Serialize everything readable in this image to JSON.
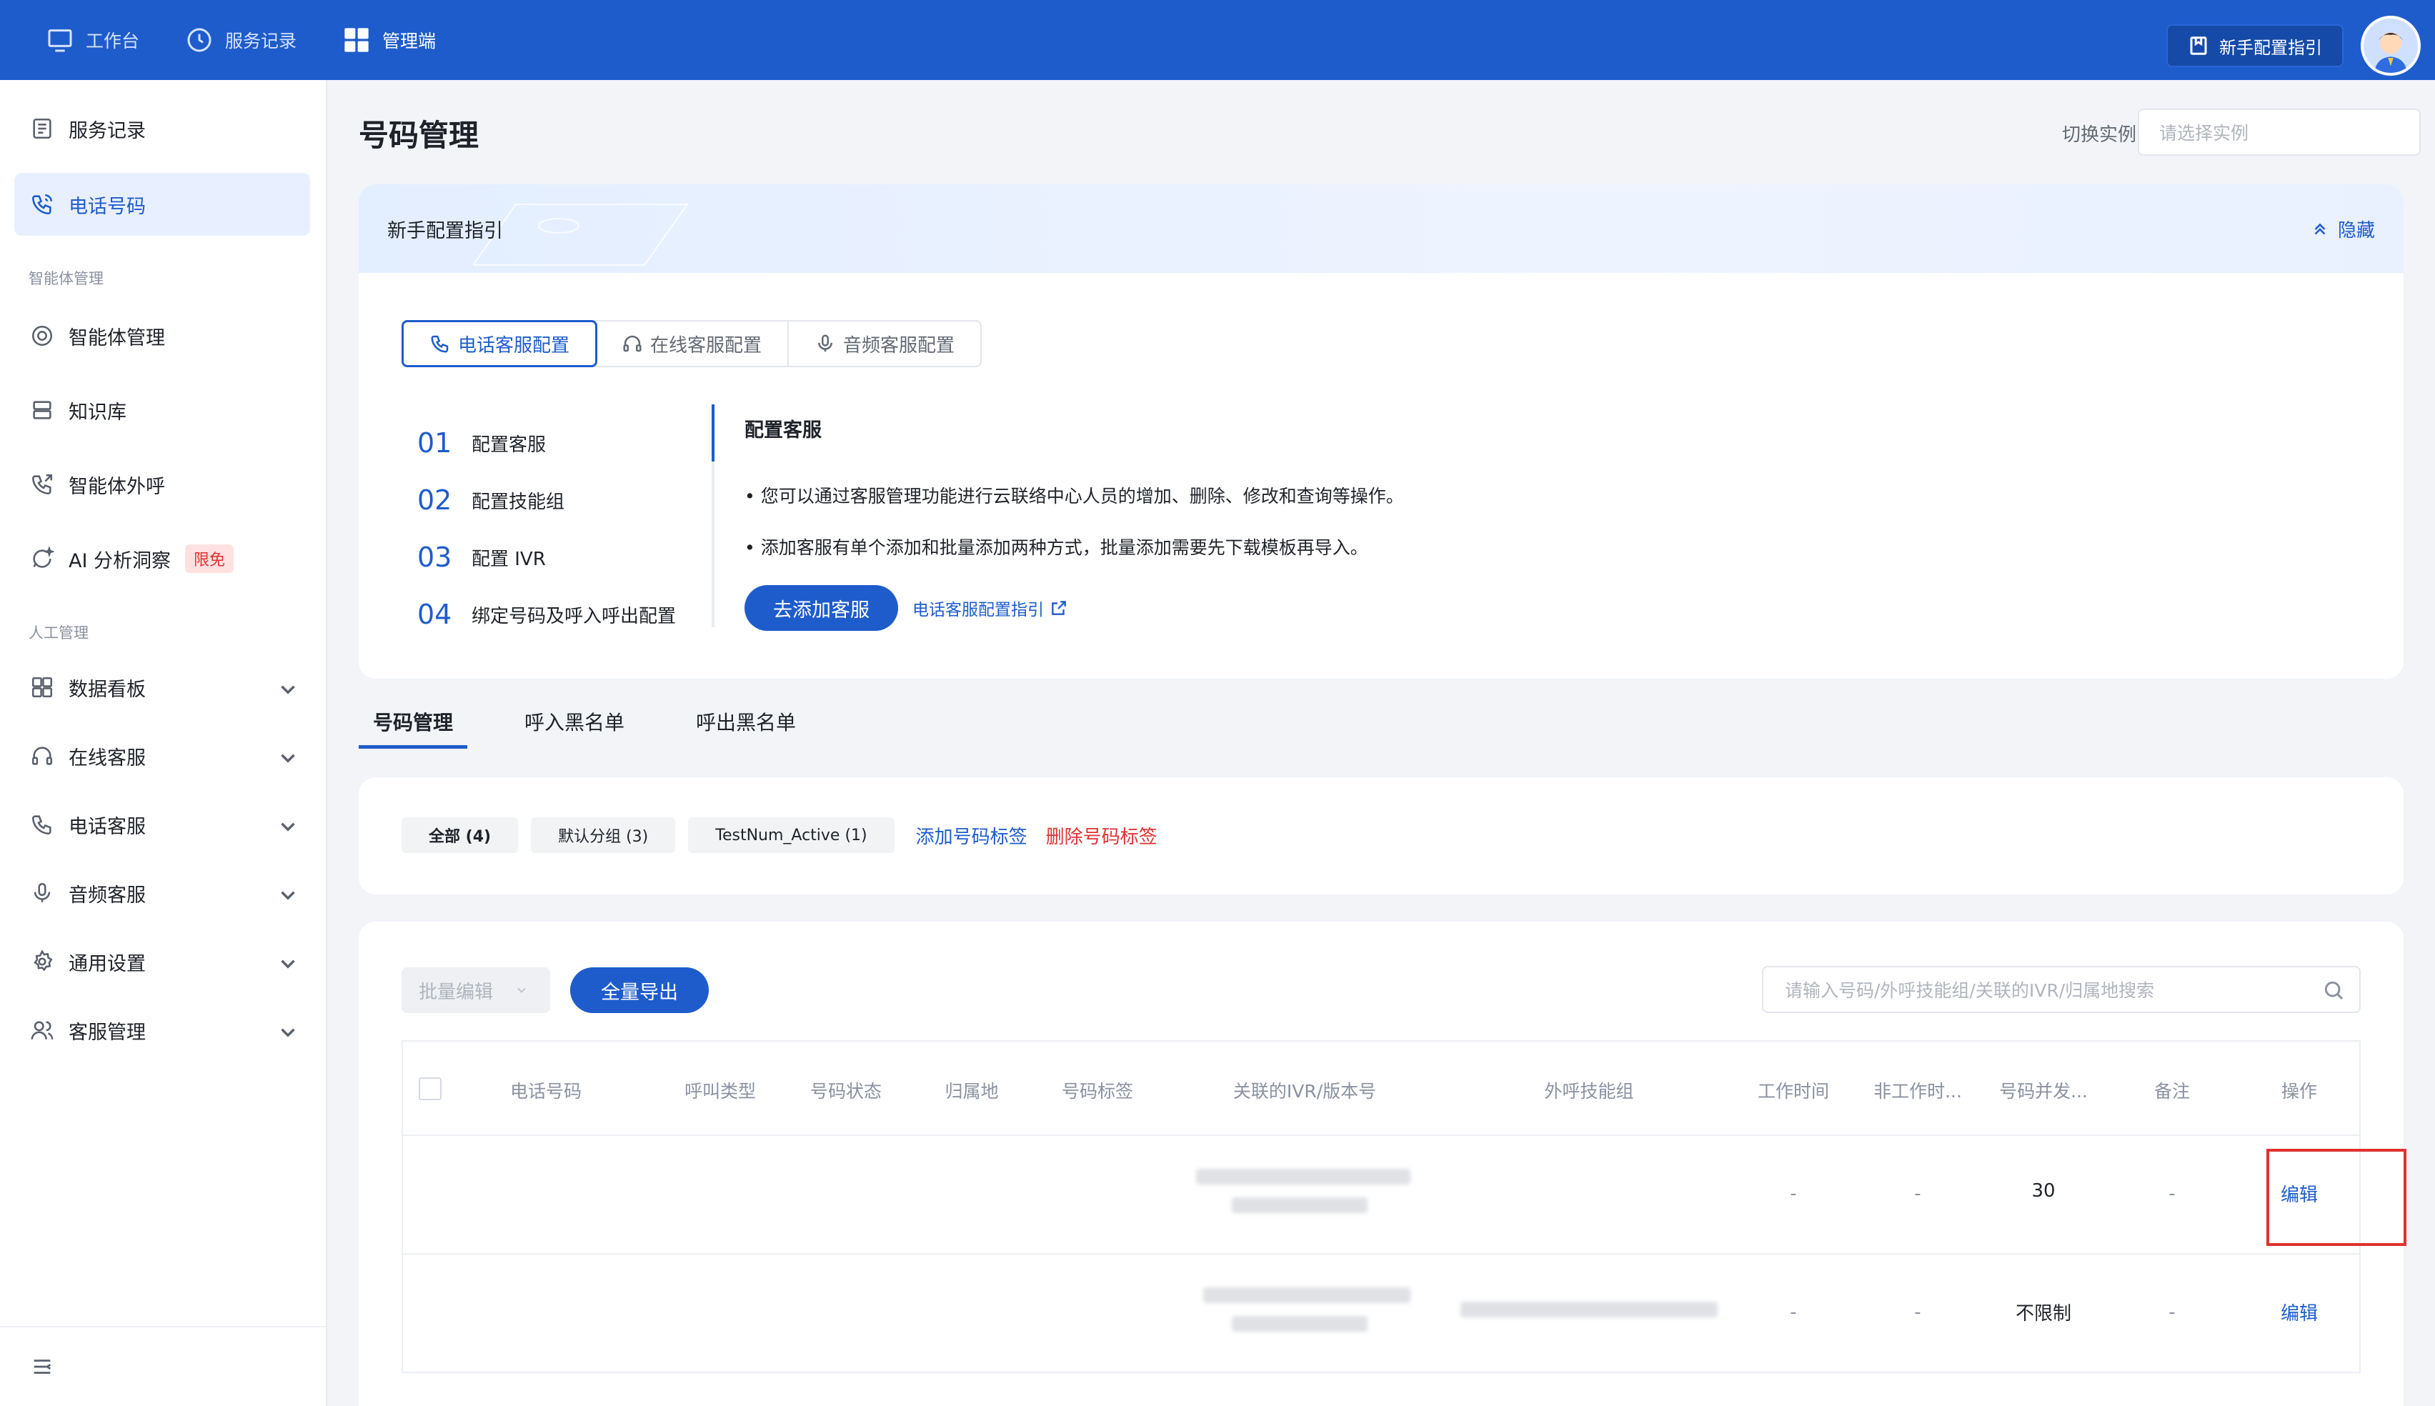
{
  "topbar": {
    "items": [
      {
        "label": "工作台",
        "icon": "monitor-icon"
      },
      {
        "label": "服务记录",
        "icon": "clock-icon"
      },
      {
        "label": "管理端",
        "icon": "grid-icon"
      }
    ],
    "guide_button": "新手配置指引"
  },
  "sidebar": {
    "items": [
      {
        "label": "服务记录"
      },
      {
        "label": "电话号码"
      },
      {
        "label": "智能体管理"
      },
      {
        "label": "知识库"
      },
      {
        "label": "智能体外呼"
      },
      {
        "label": "AI 分析洞察",
        "badge": "限免"
      },
      {
        "label": "数据看板"
      },
      {
        "label": "在线客服"
      },
      {
        "label": "电话客服"
      },
      {
        "label": "音频客服"
      },
      {
        "label": "通用设置"
      },
      {
        "label": "客服管理"
      }
    ],
    "sections": [
      "智能体管理",
      "人工管理"
    ]
  },
  "page": {
    "title": "号码管理",
    "instance_label": "切换实例",
    "instance_placeholder": "请选择实例"
  },
  "guide": {
    "title": "新手配置指引",
    "hide_label": "隐藏",
    "tabs": [
      "电话客服配置",
      "在线客服配置",
      "音频客服配置"
    ],
    "steps": [
      {
        "num": "01",
        "label": "配置客服"
      },
      {
        "num": "02",
        "label": "配置技能组"
      },
      {
        "num": "03",
        "label": "配置 IVR"
      },
      {
        "num": "04",
        "label": "绑定号码及呼入呼出配置"
      }
    ],
    "content_title": "配置客服",
    "bullets": [
      "• 您可以通过客服管理功能进行云联络中心人员的增加、删除、修改和查询等操作。",
      "• 添加客服有单个添加和批量添加两种方式，批量添加需要先下载模板再导入。"
    ],
    "primary_action": "去添加客服",
    "doc_link": "电话客服配置指引"
  },
  "main_tabs": [
    "号码管理",
    "呼入黑名单",
    "呼出黑名单"
  ],
  "filters": {
    "chips": [
      "全部 (4)",
      "默认分组 (3)",
      "TestNum_Active (1)"
    ],
    "add_tag": "添加号码标签",
    "delete_tag": "删除号码标签"
  },
  "table": {
    "batch_edit": "批量编辑",
    "export_all": "全量导出",
    "search_placeholder": "请输入号码/外呼技能组/关联的IVR/归属地搜索",
    "columns": [
      "电话号码",
      "呼叫类型",
      "号码状态",
      "归属地",
      "号码标签",
      "关联的IVR/版本号",
      "外呼技能组",
      "工作时间",
      "非工作时...",
      "号码并发...",
      "备注",
      "操作"
    ],
    "rows": [
      {
        "work_time": "-",
        "non_work_time": "-",
        "concurrency": "30",
        "remark": "-",
        "action": "编辑"
      },
      {
        "work_time": "-",
        "non_work_time": "-",
        "concurrency": "不限制",
        "remark": "-",
        "action": "编辑"
      }
    ]
  },
  "colors": {
    "primary": "#1e5ccc",
    "danger": "#e03131"
  }
}
